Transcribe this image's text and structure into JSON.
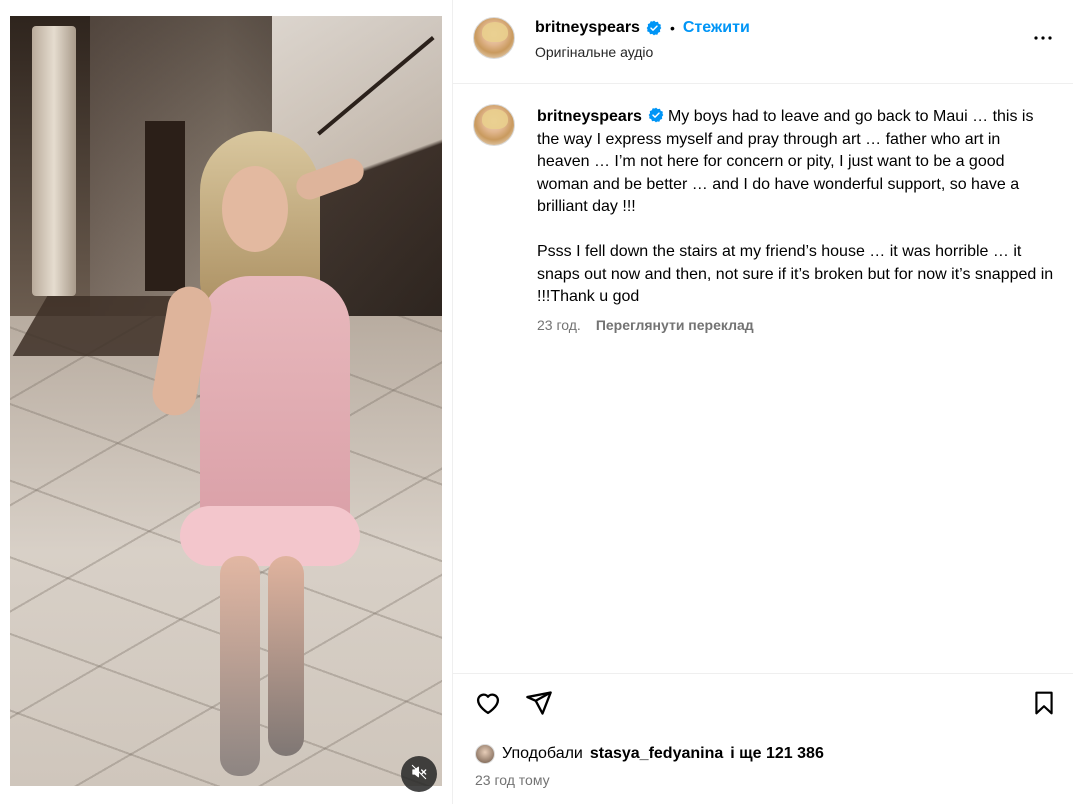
{
  "media": {
    "mute_icon": "speaker-muted-icon"
  },
  "header": {
    "username": "britneyspears",
    "separator": "•",
    "follow_label": "Стежити",
    "audio_label": "Оригінальне аудіо",
    "more_icon": "more-horizontal-icon"
  },
  "caption": {
    "username": "britneyspears",
    "paragraph1": "My boys had to leave and go back to Maui … this is the way I express myself and pray through art … father who art in heaven … I’m not here for concern or pity, I just want to be a good woman and be better … and I do have wonderful support, so have a brilliant day !!!",
    "paragraph2": "Psss I fell down the stairs at my friend’s house … it was horrible … it snaps out now and then, not sure if it’s broken but for now it’s snapped in !!!Thank u god",
    "time": "23 год.",
    "translate_label": "Переглянути переклад"
  },
  "actions": {
    "likes_prefix": "Уподобали",
    "likes_user": "stasya_fedyanina",
    "likes_suffix": "і ще 121 386",
    "posted_time": "23 год тому"
  },
  "colors": {
    "accent": "#0095f6",
    "verified": "#0095f6",
    "muted_text": "#737373",
    "divider": "#efefef"
  }
}
